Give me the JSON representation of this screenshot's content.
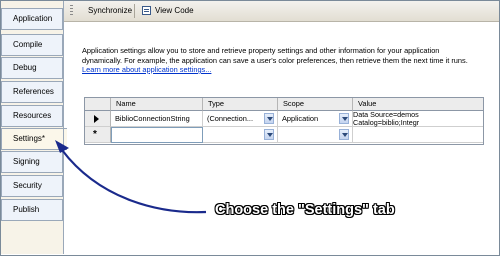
{
  "sidebar": {
    "tabs": [
      {
        "label": "Application"
      },
      {
        "label": "Compile"
      },
      {
        "label": "Debug"
      },
      {
        "label": "References"
      },
      {
        "label": "Resources"
      },
      {
        "label": "Settings*"
      },
      {
        "label": "Signing"
      },
      {
        "label": "Security"
      },
      {
        "label": "Publish"
      }
    ],
    "active": "Settings*"
  },
  "toolbar": {
    "synchronize_label": "Synchronize",
    "view_code_label": "View Code"
  },
  "description": {
    "text": "Application settings allow you to store and retrieve property settings and other information for your application dynamically. For example, the application can save a user's color preferences, then retrieve them the next time it runs.",
    "link": "Learn more about application settings..."
  },
  "grid": {
    "columns": [
      "Name",
      "Type",
      "Scope",
      "Value"
    ],
    "rows": [
      {
        "name": "BiblioConnectionString",
        "type": "(Connection...",
        "scope": "Application",
        "value_line1": "Data Source=demoserver;Initial",
        "value_line2": "Catalog=biblio;Integrated Security"
      }
    ]
  },
  "annotation": {
    "callout": "Choose the \"Settings\" tab",
    "arrow_color": "#1a2a8c"
  }
}
